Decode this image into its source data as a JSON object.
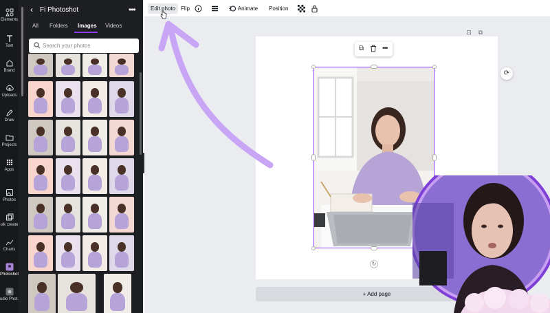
{
  "rail": {
    "items": [
      {
        "label": "Elements",
        "icon": "elements-icon"
      },
      {
        "label": "Text",
        "icon": "text-icon"
      },
      {
        "label": "Brand",
        "icon": "brand-icon"
      },
      {
        "label": "Uploads",
        "icon": "upload-cloud-icon"
      },
      {
        "label": "Draw",
        "icon": "draw-pen-icon"
      },
      {
        "label": "Projects",
        "icon": "folder-icon"
      },
      {
        "label": "Apps",
        "icon": "apps-grid-icon"
      },
      {
        "label": "Photos",
        "icon": "photos-icon"
      },
      {
        "label": "ulk create",
        "icon": "bulk-create-icon"
      },
      {
        "label": "Charts",
        "icon": "charts-icon"
      },
      {
        "label": "Photoshot",
        "icon": "photoshot-app-icon"
      },
      {
        "label": "udio Phot...",
        "icon": "studio-photo-app-icon"
      }
    ]
  },
  "panel": {
    "title": "Fi Photoshot",
    "tabs": [
      {
        "label": "All",
        "active": false
      },
      {
        "label": "Folders",
        "active": false
      },
      {
        "label": "Images",
        "active": true
      },
      {
        "label": "Videos",
        "active": false
      }
    ],
    "search": {
      "placeholder": "Search your photos",
      "value": ""
    }
  },
  "toolbar": {
    "edit_photo": "Edit photo",
    "flip": "Flip",
    "animate": "Animate",
    "position": "Position"
  },
  "canvas": {
    "add_page": "+ Add page"
  },
  "colors": {
    "accent": "#8b3dff",
    "arrow": "#c8a6f5",
    "panel_bg": "#1e1f22",
    "rail_bg": "#18191b",
    "canvas_bg": "#ebecf0"
  }
}
